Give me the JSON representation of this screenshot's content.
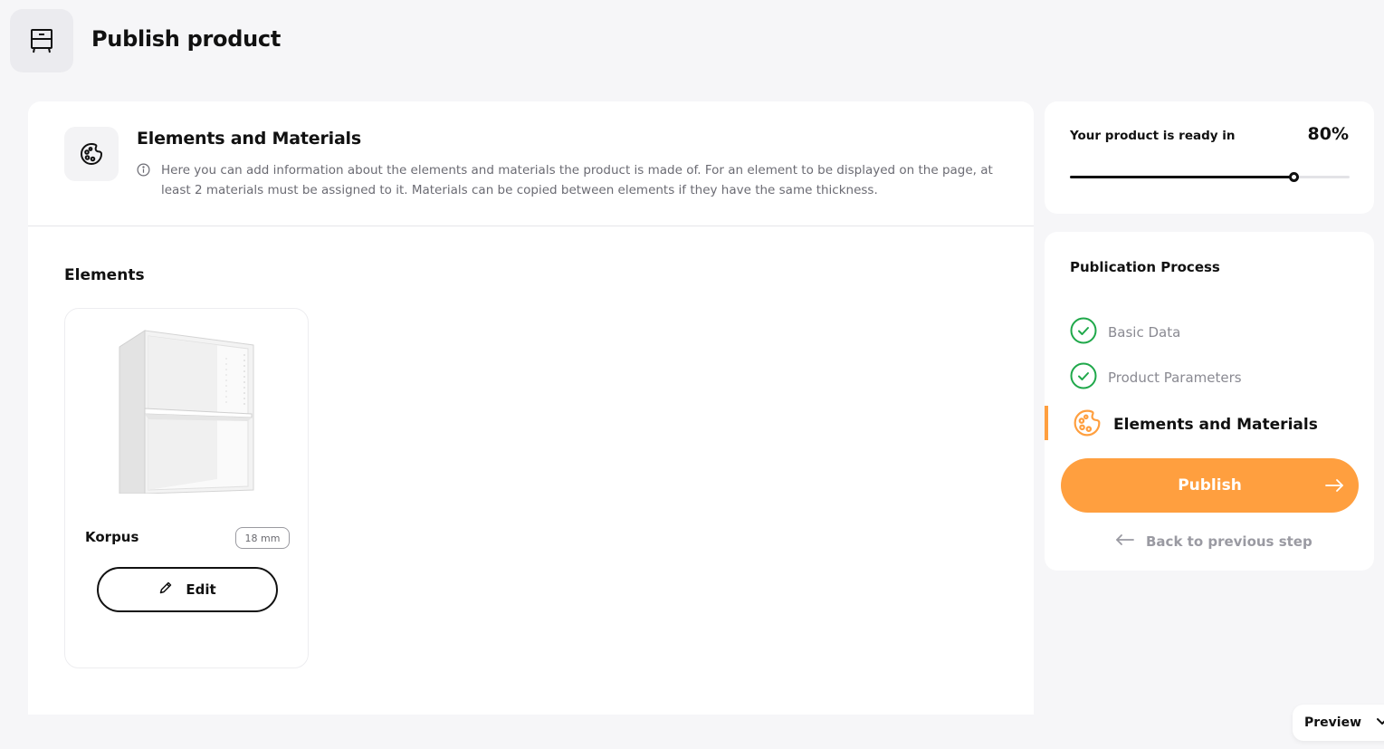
{
  "header": {
    "title": "Publish product",
    "icon": "cabinet-icon"
  },
  "section": {
    "title": "Elements and Materials",
    "icon": "palette-icon",
    "description": "Here you can add information about the elements and materials the product is made of. For an element to be displayed on the page, at least 2 materials must be assigned to it. Materials can be copied between elements if they have the same thickness."
  },
  "elements": {
    "title": "Elements",
    "items": [
      {
        "name": "Korpus",
        "thickness": "18 mm",
        "edit_label": "Edit",
        "image": "white-shelf-cabinet"
      }
    ]
  },
  "progress": {
    "label": "Your product is ready in",
    "value_text": "80%",
    "value": 0.8
  },
  "process": {
    "title": "Publication Process",
    "steps": [
      {
        "label": "Basic Data",
        "status": "done"
      },
      {
        "label": "Product Parameters",
        "status": "done"
      },
      {
        "label": "Elements and Materials",
        "status": "active"
      }
    ],
    "publish_label": "Publish",
    "back_label": "Back to previous step"
  },
  "preview": {
    "label": "Preview"
  },
  "colors": {
    "accent": "#ff9f3f",
    "success": "#1fa84a",
    "text": "#111111",
    "muted": "#8a8a92",
    "background": "#f6f6f8"
  }
}
